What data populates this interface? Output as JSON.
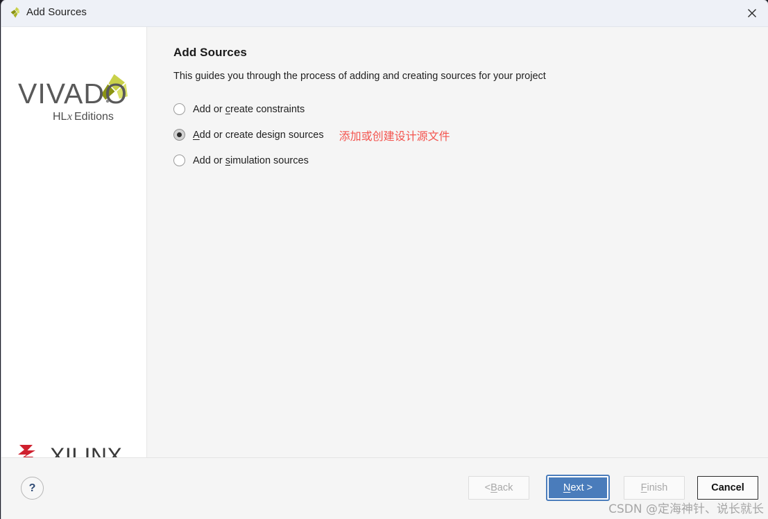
{
  "window": {
    "title": "Add Sources",
    "title_icon": "vivado-pinwheel-icon",
    "close_label": "×"
  },
  "sidebar": {
    "product_logo": {
      "name": "VIVADO",
      "subtitle": "HLx Editions"
    },
    "vendor_logo": {
      "name": "XILINX"
    }
  },
  "main": {
    "heading": "Add Sources",
    "description": "This guides you through the process of adding and creating sources for your project",
    "options": [
      {
        "id": "constraints",
        "pre": "Add or ",
        "mnemonic": "c",
        "post": "reate constraints",
        "checked": false
      },
      {
        "id": "design-sources",
        "pre": "",
        "mnemonic": "A",
        "post": "dd or create design sources",
        "checked": true,
        "annotation": "添加或创建设计源文件"
      },
      {
        "id": "simulation-sources",
        "pre": "Add or ",
        "mnemonic": "s",
        "post": "imulation sources",
        "checked": false
      }
    ]
  },
  "footer": {
    "help_label": "?",
    "buttons": {
      "back": {
        "pre": "< ",
        "mnemonic": "B",
        "post": "ack",
        "state": "disabled"
      },
      "next": {
        "pre": "",
        "mnemonic": "N",
        "post": "ext >",
        "state": "primary"
      },
      "finish": {
        "pre": "",
        "mnemonic": "F",
        "post": "inish",
        "state": "disabled"
      },
      "cancel": {
        "pre": "Cancel",
        "mnemonic": "",
        "post": "",
        "state": "default"
      }
    }
  },
  "watermark": {
    "text": "CSDN @定海神针、说长就长"
  },
  "colors": {
    "accent_blue": "#4a7cbb",
    "annotation_red": "#f4544e",
    "vivado_olive": "#9aa31e",
    "vivado_lime": "#d7de5e",
    "xilinx_red": "#cf202e",
    "titlebar_bg": "#eef1f7",
    "content_bg": "#f5f5f5"
  }
}
